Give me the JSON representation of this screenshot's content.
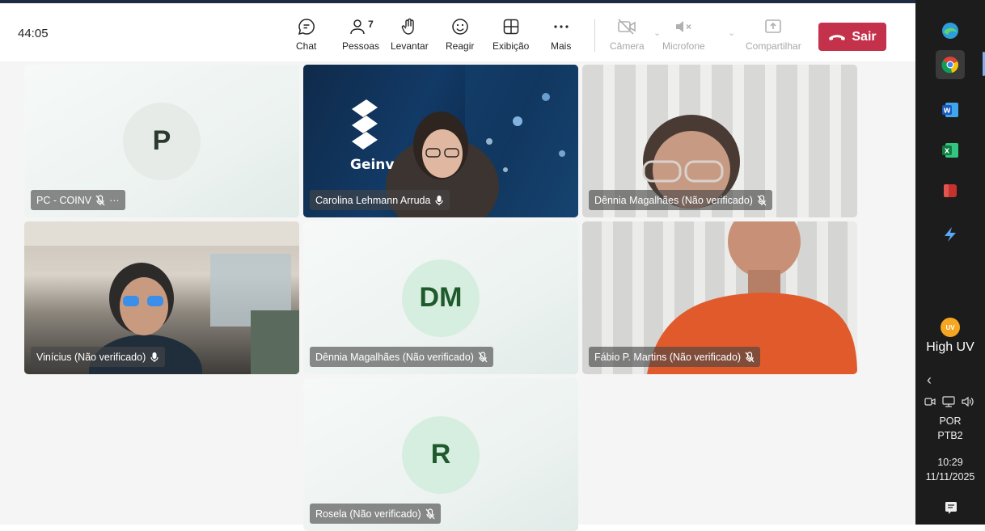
{
  "toolbar": {
    "timer": "44:05",
    "chat": "Chat",
    "people": "Pessoas",
    "people_count": "7",
    "raise": "Levantar",
    "react": "Reagir",
    "view": "Exibição",
    "more": "Mais",
    "camera": "Câmera",
    "mic": "Microfone",
    "share": "Compartilhar",
    "leave": "Sair"
  },
  "participants": [
    {
      "name": "PC - COINV",
      "initials": "P",
      "muted": true,
      "more": "···"
    },
    {
      "name": "Carolina Lehmann Arruda",
      "muted": false,
      "video": true
    },
    {
      "name": "Dênnia Magalhães (Não verificado)",
      "muted": true,
      "video": true
    },
    {
      "name": "Vinícius (Não verificado)",
      "muted": false,
      "video": true
    },
    {
      "name": "Dênnia Magalhães (Não verificado)",
      "initials": "DM",
      "muted": true
    },
    {
      "name": "Fábio P. Martins (Não verificado)",
      "muted": true,
      "video": true
    },
    {
      "name": "Rosela (Não verificado)",
      "initials": "R",
      "muted": true
    }
  ],
  "video_overlays": {
    "carolina_logo": "Geinv"
  },
  "taskbar": {
    "weather": "High UV",
    "weather_badge": "UV",
    "lang1": "POR",
    "lang2": "PTB2",
    "time": "10:29",
    "date": "11/11/2025"
  },
  "colors": {
    "leave": "#c4314b",
    "avatar_bg": "#dfece6",
    "avatar_dm_bg": "#d6eedf",
    "avatar_text": "#1f5a2c"
  }
}
